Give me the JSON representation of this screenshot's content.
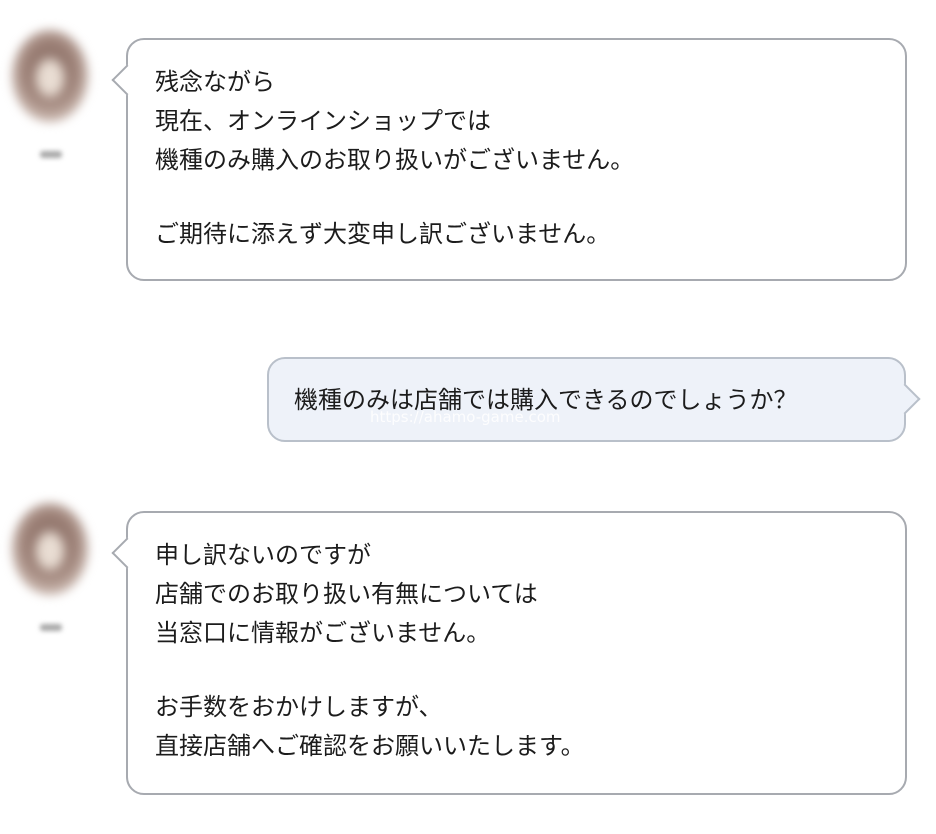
{
  "conversation": {
    "message1": {
      "sender": "operator",
      "lines": [
        "残念ながら",
        "現在、オンラインショップでは",
        "機種のみ購入のお取り扱いがございません。",
        "",
        "ご期待に添えず大変申し訳ございません。"
      ]
    },
    "message2": {
      "sender": "user",
      "lines": [
        "機種のみは店舗では購入できるのでしょうか？"
      ]
    },
    "message3": {
      "sender": "operator",
      "lines": [
        "申し訳ないのですが",
        "店舗でのお取り扱い有無については",
        "当窓口に情報がございません。",
        "",
        "お手数をおかけしますが、",
        "直接店舗へご確認をお願いいたします。"
      ]
    }
  },
  "watermark": "https://ahamo-game.com",
  "colors": {
    "operator_bubble": "#ffffff",
    "operator_border": "#a7aab0",
    "user_bubble": "#eef2f9",
    "user_border": "#b9c0ca"
  }
}
